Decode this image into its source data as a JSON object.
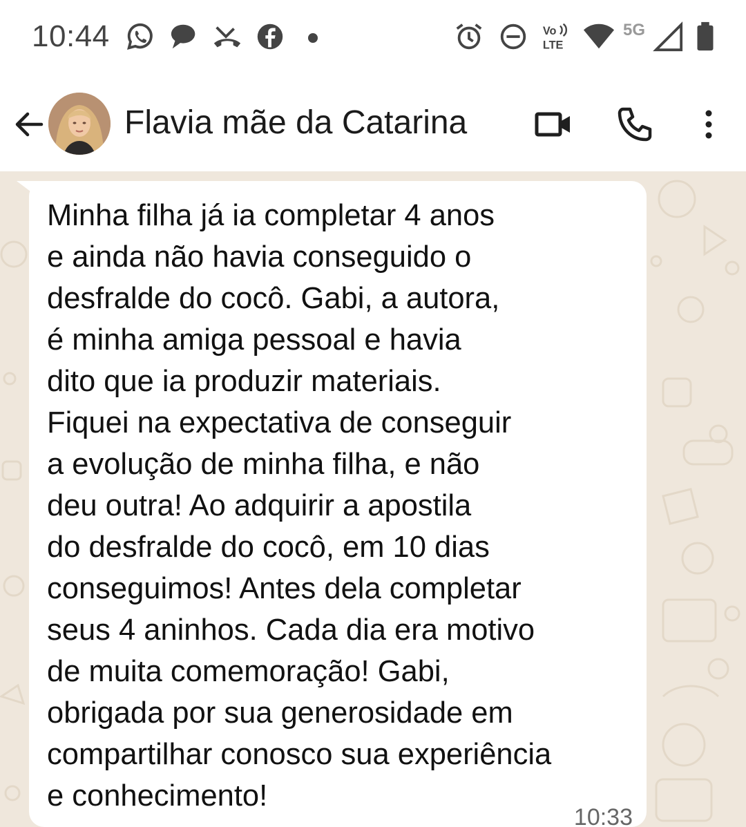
{
  "status_bar": {
    "time": "10:44",
    "network": "5G",
    "notification_icons": [
      "whatsapp-icon",
      "chat-bubble-icon",
      "missed-call-icon",
      "facebook-icon",
      "more-dot-icon"
    ],
    "system_icons": [
      "alarm-icon",
      "do-not-disturb-icon",
      "volte-icon",
      "wifi-icon",
      "signal-icon",
      "battery-icon"
    ],
    "volte_label": "Vo LTE"
  },
  "header": {
    "contact_name": "Flavia mãe da Catarina",
    "actions": [
      "video-call-icon",
      "voice-call-icon",
      "more-options-icon"
    ]
  },
  "message": {
    "lines": [
      "Minha filha já ia completar 4 anos",
      "e ainda não havia conseguido o",
      "desfralde do cocô. Gabi, a autora,",
      "é minha amiga pessoal e havia",
      "dito que ia produzir materiais.",
      "Fiquei na expectativa de conseguir",
      "a evolução de minha filha, e não",
      "deu outra! Ao adquirir a apostila",
      "do desfralde do cocô, em 10 dias",
      "conseguimos! Antes dela completar",
      "seus 4 aninhos. Cada dia era motivo",
      "de muita comemoração! Gabi,",
      "obrigada por sua generosidade em",
      "compartilhar conosco sua experiência",
      "e conhecimento!"
    ],
    "time": "10:33"
  },
  "colors": {
    "wallpaper": "#efe7dc",
    "bubble": "#ffffff",
    "icon_dark": "#1f1f1f",
    "status_icon": "#444444"
  }
}
